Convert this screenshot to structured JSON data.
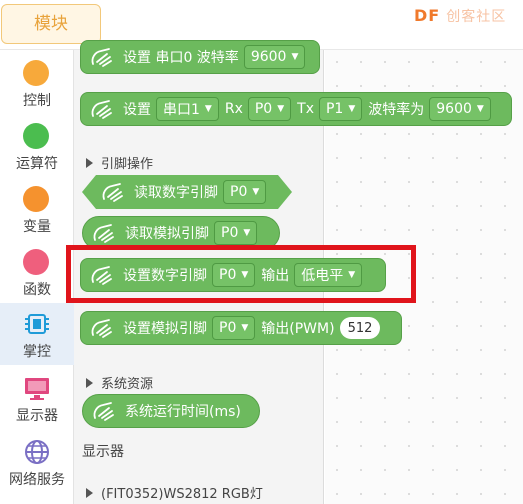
{
  "topbar": {
    "module_tab": "模块",
    "logo_text": "DF",
    "logo_sub": "创客社区"
  },
  "categories": [
    {
      "label": "控制",
      "color": "#f7a93b"
    },
    {
      "label": "运算符",
      "color": "#4bbd4f"
    },
    {
      "label": "变量",
      "color": "#f5922e"
    },
    {
      "label": "函数",
      "color": "#ef5f7d"
    },
    {
      "label": "掌控",
      "color": "#1f9bd8",
      "icon": "chip-icon",
      "active": true
    },
    {
      "label": "显示器",
      "color": "#e0477f",
      "icon": "monitor-icon"
    },
    {
      "label": "网络服务",
      "color": "#7a6fc4",
      "icon": "globe-icon"
    }
  ],
  "blocks": {
    "b1": {
      "text": "设置 串口0 波特率",
      "dd1": "9600"
    },
    "b2": {
      "t1": "设置",
      "dd1": "串口1",
      "t2": "Rx",
      "dd2": "P0",
      "t3": "Tx",
      "dd3": "P1",
      "t4": "波特率为",
      "dd4": "9600"
    },
    "section_pins": "引脚操作",
    "b3": {
      "text": "读取数字引脚",
      "dd1": "P0"
    },
    "b4": {
      "text": "读取模拟引脚",
      "dd1": "P0"
    },
    "b5": {
      "text": "设置数字引脚",
      "dd1": "P0",
      "t2": "输出",
      "dd2": "低电平"
    },
    "b6": {
      "text": "设置模拟引脚",
      "dd1": "P0",
      "t2": "输出(PWM)",
      "val": "512"
    },
    "section_sys": "系统资源",
    "b7": {
      "text": "系统运行时间(ms)"
    },
    "title_display": "显示器",
    "section_rgb": "(FIT0352)WS2812 RGB灯"
  },
  "colors": {
    "block": "#6dba5e",
    "highlight": "#e0141b",
    "accent": "#f07a2c"
  }
}
